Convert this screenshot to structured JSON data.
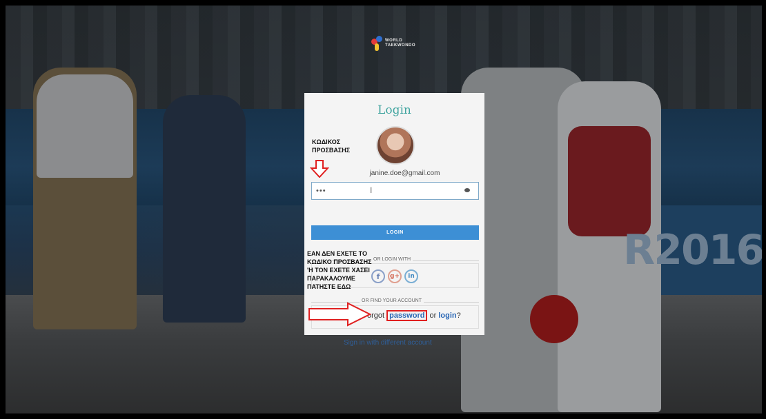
{
  "header": {
    "logo_line1": "WORLD",
    "logo_line2": "TAEKWONDO"
  },
  "background": {
    "rio_text": "R2016"
  },
  "login": {
    "title": "Login",
    "email": "janine.doe@gmail.com",
    "password_value": "•••",
    "button_label": "LOGIN",
    "or_login_with": "OR LOGIN WITH",
    "or_find_account": "OR FIND YOUR ACCOUNT",
    "forgot_prefix": "Forgot",
    "password_link": "password",
    "or_word": "or",
    "login_link": "login",
    "question_mark": "?",
    "sign_in_different": "Sign in with different account"
  },
  "social": {
    "facebook": "f",
    "google_plus": "g+",
    "linkedin": "in"
  },
  "annotations": {
    "password_note_line1": "ΚΩΔΙΚΟΣ",
    "password_note_line2": "ΠΡΟΣΒΑΣΗΣ",
    "forgot_note_line1": "ΕΑΝ ΔΕΝ ΕΧΕΤΕ ΤΟ",
    "forgot_note_line2": "ΚΩΔΙΚΟ ΠΡΟΣΒΑΣΗΣ",
    "forgot_note_line3": "'Η ΤΟΝ ΕΧΕΤΕ ΧΑΣΕΙ",
    "forgot_note_line4": "ΠΑΡΑΚΑΛΟΥΜΕ",
    "forgot_note_line5": "ΠΑΤΗΣΤΕ ΕΔΩ"
  },
  "colors": {
    "title_teal": "#42a5a0",
    "button_blue": "#3d8fd5",
    "link_blue": "#2a67b5",
    "annotation_red": "#e02020"
  }
}
